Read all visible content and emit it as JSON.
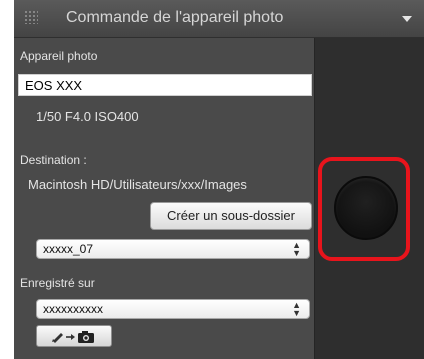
{
  "panel": {
    "title": "Commande de l'appareil photo"
  },
  "camera": {
    "label": "Appareil photo",
    "model": "EOS XXX",
    "settings": "1/50  F4.0  ISO400"
  },
  "destination": {
    "label": "Destination :",
    "path": "Macintosh HD/Utilisateurs/xxx/Images",
    "create_subfolder_button": "Créer un sous-dossier",
    "folder_select_value": "xxxxx_07"
  },
  "save_to": {
    "label": "Enregistré sur",
    "select_value": "xxxxxxxxxx"
  },
  "icons": {
    "title_grip": "grip-icon",
    "collapse": "triangle-down-icon",
    "transfer": "pencil-arrow-camera-icon",
    "shutter": "shutter-release-icon"
  },
  "colors": {
    "highlight": "#e8141c",
    "panel_bg": "#4a4a4a",
    "shutter_panel_bg": "#2e2e2e"
  }
}
